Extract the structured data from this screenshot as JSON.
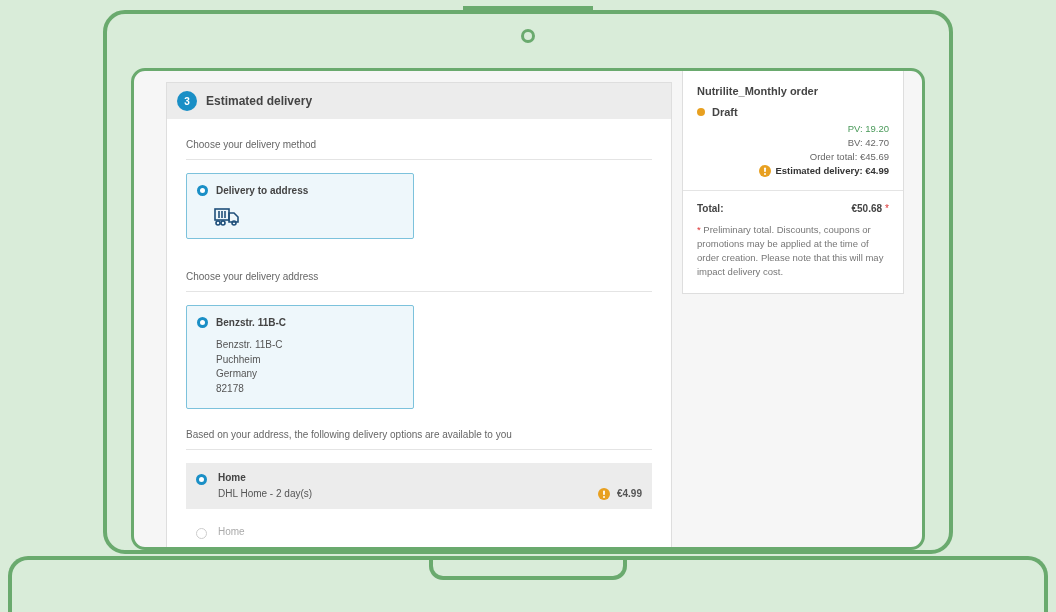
{
  "step": {
    "number": "3",
    "title": "Estimated delivery"
  },
  "method": {
    "label": "Choose your delivery method",
    "options": [
      {
        "name": "Delivery to address",
        "selected": true
      }
    ]
  },
  "address": {
    "label": "Choose your delivery address",
    "options": [
      {
        "name": "Benzstr. 11B-C",
        "lines": [
          "Benzstr. 11B-C",
          "Puchheim",
          "Germany",
          "82178"
        ],
        "selected": true
      }
    ]
  },
  "delivery_options": {
    "label": "Based on your address, the following delivery options are available to you",
    "options": [
      {
        "name": "Home",
        "detail": "DHL Home - 2 day(s)",
        "price": "€4.99",
        "selected": true
      },
      {
        "name": "Home",
        "selected": false
      }
    ]
  },
  "summary": {
    "title": "Nutrilite_Monthly order",
    "status": {
      "label": "Draft",
      "color": "#e8a020"
    },
    "figures": [
      {
        "kind": "pv",
        "text": "PV: 19.20"
      },
      {
        "kind": "plain",
        "text": "BV: 42.70"
      },
      {
        "kind": "plain",
        "text": "Order total: €45.69"
      },
      {
        "kind": "warning",
        "text": "Estimated delivery: €4.99"
      }
    ],
    "total_label": "Total:",
    "total_value": "€50.68",
    "total_mark": "*",
    "note_mark": "*",
    "note": "Preliminary total. Discounts, coupons or promotions may be applied at the time of order creation. Please note that this will may impact delivery cost."
  }
}
